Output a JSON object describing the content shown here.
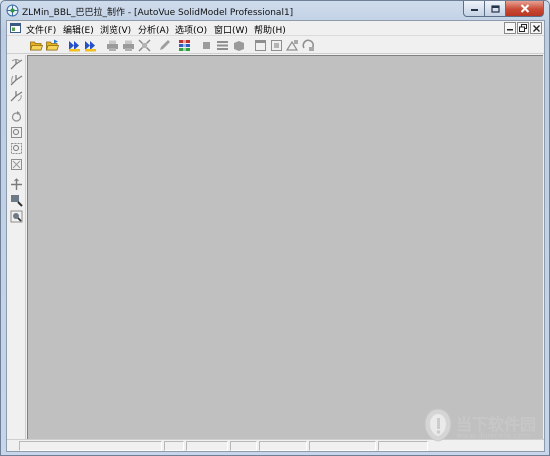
{
  "window": {
    "title": "ZLMin_BBL_巴巴拉_制作 - [AutoVue SolidModel Professional1]"
  },
  "menu": {
    "items": [
      {
        "label": "文件(F)"
      },
      {
        "label": "编辑(E)"
      },
      {
        "label": "浏览(V)"
      },
      {
        "label": "分析(A)"
      },
      {
        "label": "选项(O)"
      },
      {
        "label": "窗口(W)"
      },
      {
        "label": "帮助(H)"
      }
    ]
  },
  "toolbar": {
    "icons": [
      "open-folder-icon",
      "open-folder-2-icon",
      "prev-page-icon",
      "next-page-icon",
      "print-icon",
      "print-preview-icon",
      "measure-icon",
      "markup-pen-icon",
      "layers-icon",
      "view-front-icon",
      "view-stack-icon",
      "view-box-icon",
      "frame-icon",
      "frame-fit-icon",
      "frame-zoom-icon",
      "frame-rotate-icon"
    ]
  },
  "sidebar": {
    "icons": [
      "rotate-x-icon",
      "rotate-y-icon",
      "rotate-z-icon",
      "orbit-icon",
      "zoom-fit-icon",
      "zoom-window-icon",
      "zoom-extents-icon",
      "pan-icon",
      "magnify-icon",
      "magnify-area-icon"
    ]
  },
  "statusbar": {
    "panels": [
      "",
      "",
      "",
      "",
      "",
      "",
      ""
    ]
  },
  "watermark": {
    "brand": "当下软件园",
    "url": "www.downxia.com"
  },
  "colors": {
    "workspace": "#c0c0c0",
    "close_button": "#c94a36",
    "chrome": "#f0f0f0"
  }
}
